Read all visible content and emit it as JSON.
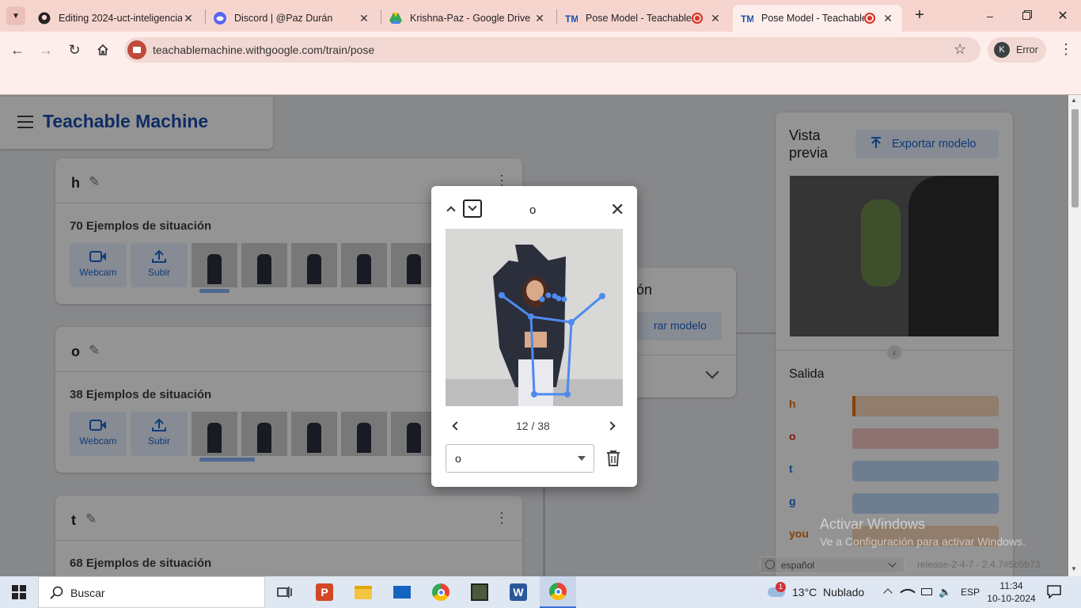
{
  "browser": {
    "tabs": [
      {
        "title": "Editing 2024-uct-inteligencia",
        "icon": "github-icon"
      },
      {
        "title": "Discord | @Paz Durán",
        "icon": "discord-icon"
      },
      {
        "title": "Krishna-Paz - Google Drive",
        "icon": "drive-icon"
      },
      {
        "title": "Pose Model - Teachable",
        "icon": "teachable-icon"
      },
      {
        "title": "Pose Model - Teachable",
        "icon": "teachable-icon"
      }
    ],
    "url": "teachablemachine.withgoogle.com/train/pose",
    "profile_label": "Error",
    "profile_initial": "K"
  },
  "app": {
    "title": "Teachable Machine"
  },
  "classes": [
    {
      "name": "h",
      "samples_label": "70 Ejemplos de situación"
    },
    {
      "name": "o",
      "samples_label": "38 Ejemplos de situación"
    },
    {
      "name": "t",
      "samples_label": "68 Ejemplos de situación"
    }
  ],
  "source_buttons": {
    "webcam": "Webcam",
    "upload": "Subir"
  },
  "training": {
    "title_fragment": "ión",
    "button_fragment": "rar modelo"
  },
  "preview": {
    "title_line1": "Vista",
    "title_line2": "previa",
    "export_label": "Exportar modelo",
    "output_title": "Salida",
    "outputs": [
      {
        "label": "h",
        "color": "#e8710a",
        "level": 0.02
      },
      {
        "label": "o",
        "color": "#d93025",
        "level": 0
      },
      {
        "label": "t",
        "color": "#1a73e8",
        "level": 0
      },
      {
        "label": "g",
        "color": "#1a73e8",
        "level": 0
      },
      {
        "label": "you",
        "color": "#e8710a",
        "level": 0
      }
    ]
  },
  "modal": {
    "class_name": "o",
    "counter": "12 / 38",
    "select_value": "o"
  },
  "footer": {
    "language": "español",
    "version": "release-2-4-7 - 2.4.7#5b5b73"
  },
  "watermark": {
    "line1": "Activar Windows",
    "line2": "Ve a Configuración para activar Windows."
  },
  "taskbar": {
    "search_placeholder": "Buscar",
    "weather": "13°C  Nublado",
    "weather_badge": "1",
    "language": "ESP",
    "time": "11:34",
    "date": "10-10-2024"
  }
}
